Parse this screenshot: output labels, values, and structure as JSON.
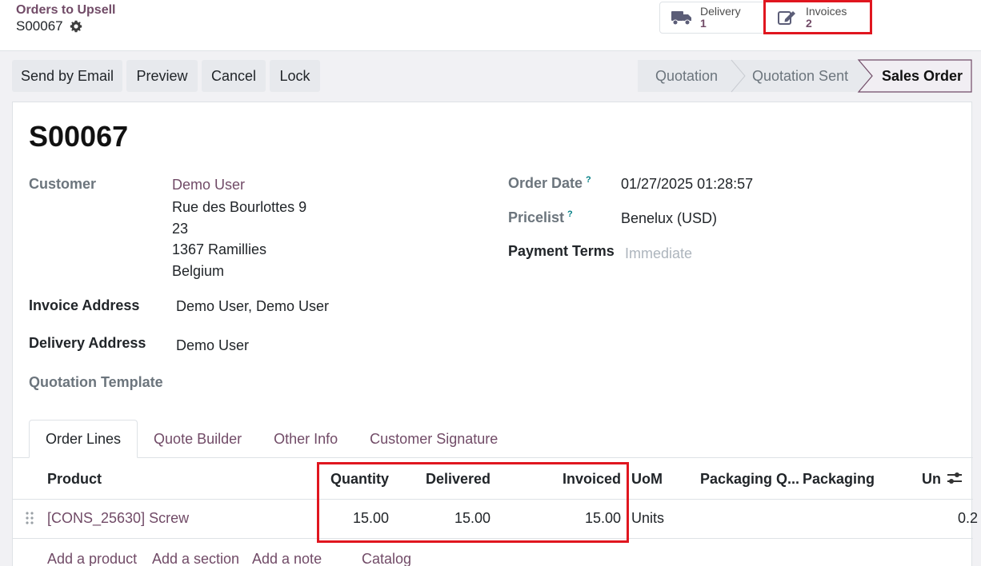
{
  "breadcrumb": {
    "parent": "Orders to Upsell",
    "current": "S00067"
  },
  "smart_buttons": [
    {
      "label": "Delivery",
      "value": "1",
      "icon": "truck-icon"
    },
    {
      "label": "Invoices",
      "value": "2",
      "icon": "pencil-square-icon"
    }
  ],
  "actions": {
    "send_email": "Send by Email",
    "preview": "Preview",
    "cancel": "Cancel",
    "lock": "Lock"
  },
  "stages": {
    "items": [
      "Quotation",
      "Quotation Sent",
      "Sales Order"
    ],
    "active": "Sales Order"
  },
  "record": {
    "title": "S00067",
    "customer_label": "Customer",
    "customer_name": "Demo User",
    "customer_address": [
      "Rue des Bourlottes 9",
      "23",
      "1367 Ramillies",
      "Belgium"
    ],
    "invoice_address_label": "Invoice Address",
    "invoice_address": "Demo User, Demo User",
    "delivery_address_label": "Delivery Address",
    "delivery_address": "Demo User",
    "quotation_template_label": "Quotation Template",
    "order_date_label": "Order Date",
    "order_date": "01/27/2025 01:28:57",
    "pricelist_label": "Pricelist",
    "pricelist": "Benelux (USD)",
    "payment_terms_label": "Payment Terms",
    "payment_terms_placeholder": "Immediate",
    "help_mark": "?"
  },
  "tabs": [
    "Order Lines",
    "Quote Builder",
    "Other Info",
    "Customer Signature"
  ],
  "table": {
    "headers": {
      "product": "Product",
      "quantity": "Quantity",
      "delivered": "Delivered",
      "invoiced": "Invoiced",
      "uom": "UoM",
      "packaging_qty": "Packaging Q...",
      "packaging": "Packaging",
      "unit_price": "Un"
    },
    "rows": [
      {
        "product": "[CONS_25630] Screw",
        "quantity": "15.00",
        "delivered": "15.00",
        "invoiced": "15.00",
        "uom": "Units",
        "unit_price": "0.2"
      }
    ],
    "add_links": [
      "Add a product",
      "Add a section",
      "Add a note",
      "Catalog"
    ]
  },
  "colors": {
    "brand": "#714b67",
    "highlight": "#e0161f",
    "help": "#017e84"
  }
}
